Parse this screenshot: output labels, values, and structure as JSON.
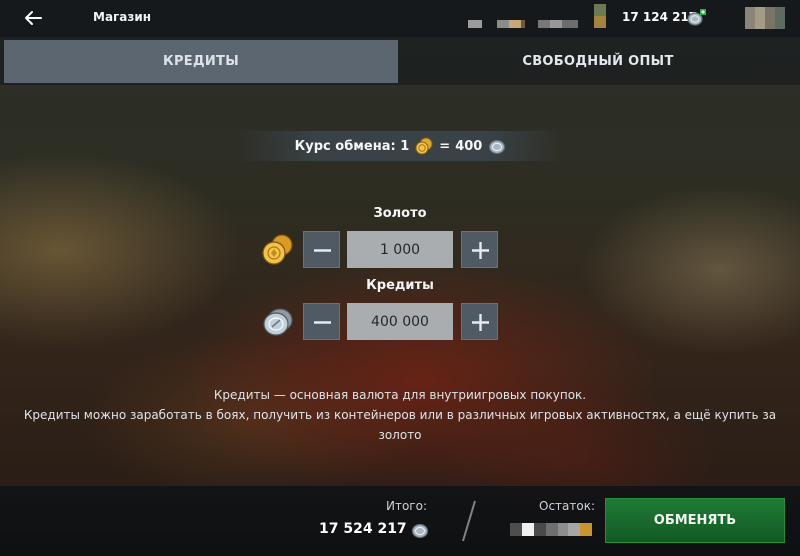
{
  "header": {
    "title": "Магазин",
    "credits_balance": "17 124 217",
    "back_icon": "arrow-left-icon",
    "plus_icon": "green-plus-icon"
  },
  "tabs": [
    {
      "label": "КРЕДИТЫ",
      "active": true
    },
    {
      "label": "СВОБОДНЫЙ ОПЫТ",
      "active": false
    }
  ],
  "exchange": {
    "rate_prefix": "Курс обмена: 1",
    "rate_eq": "=",
    "rate_value": "400",
    "gold_label": "Золото",
    "gold_value": "1 000",
    "credits_label": "Кредиты",
    "credits_value": "400 000"
  },
  "description": {
    "line1": "Кредиты — основная валюта для внутриигровых покупок.",
    "line2": "Кредиты можно заработать в боях, получить из контейнеров или в различных игровых активностях, а ещё купить за",
    "line3": "золото"
  },
  "footer": {
    "total_label": "Итого:",
    "total_value": "17 524 217",
    "remaining_label": "Остаток:",
    "exchange_button": "ОБМЕНЯТЬ"
  },
  "colors": {
    "accent_green": "#1f7a34",
    "tab_active": "#5b6670",
    "stepper": "#4f5a64",
    "gold": "#d9a52a",
    "silver": "#b7c4cf"
  }
}
